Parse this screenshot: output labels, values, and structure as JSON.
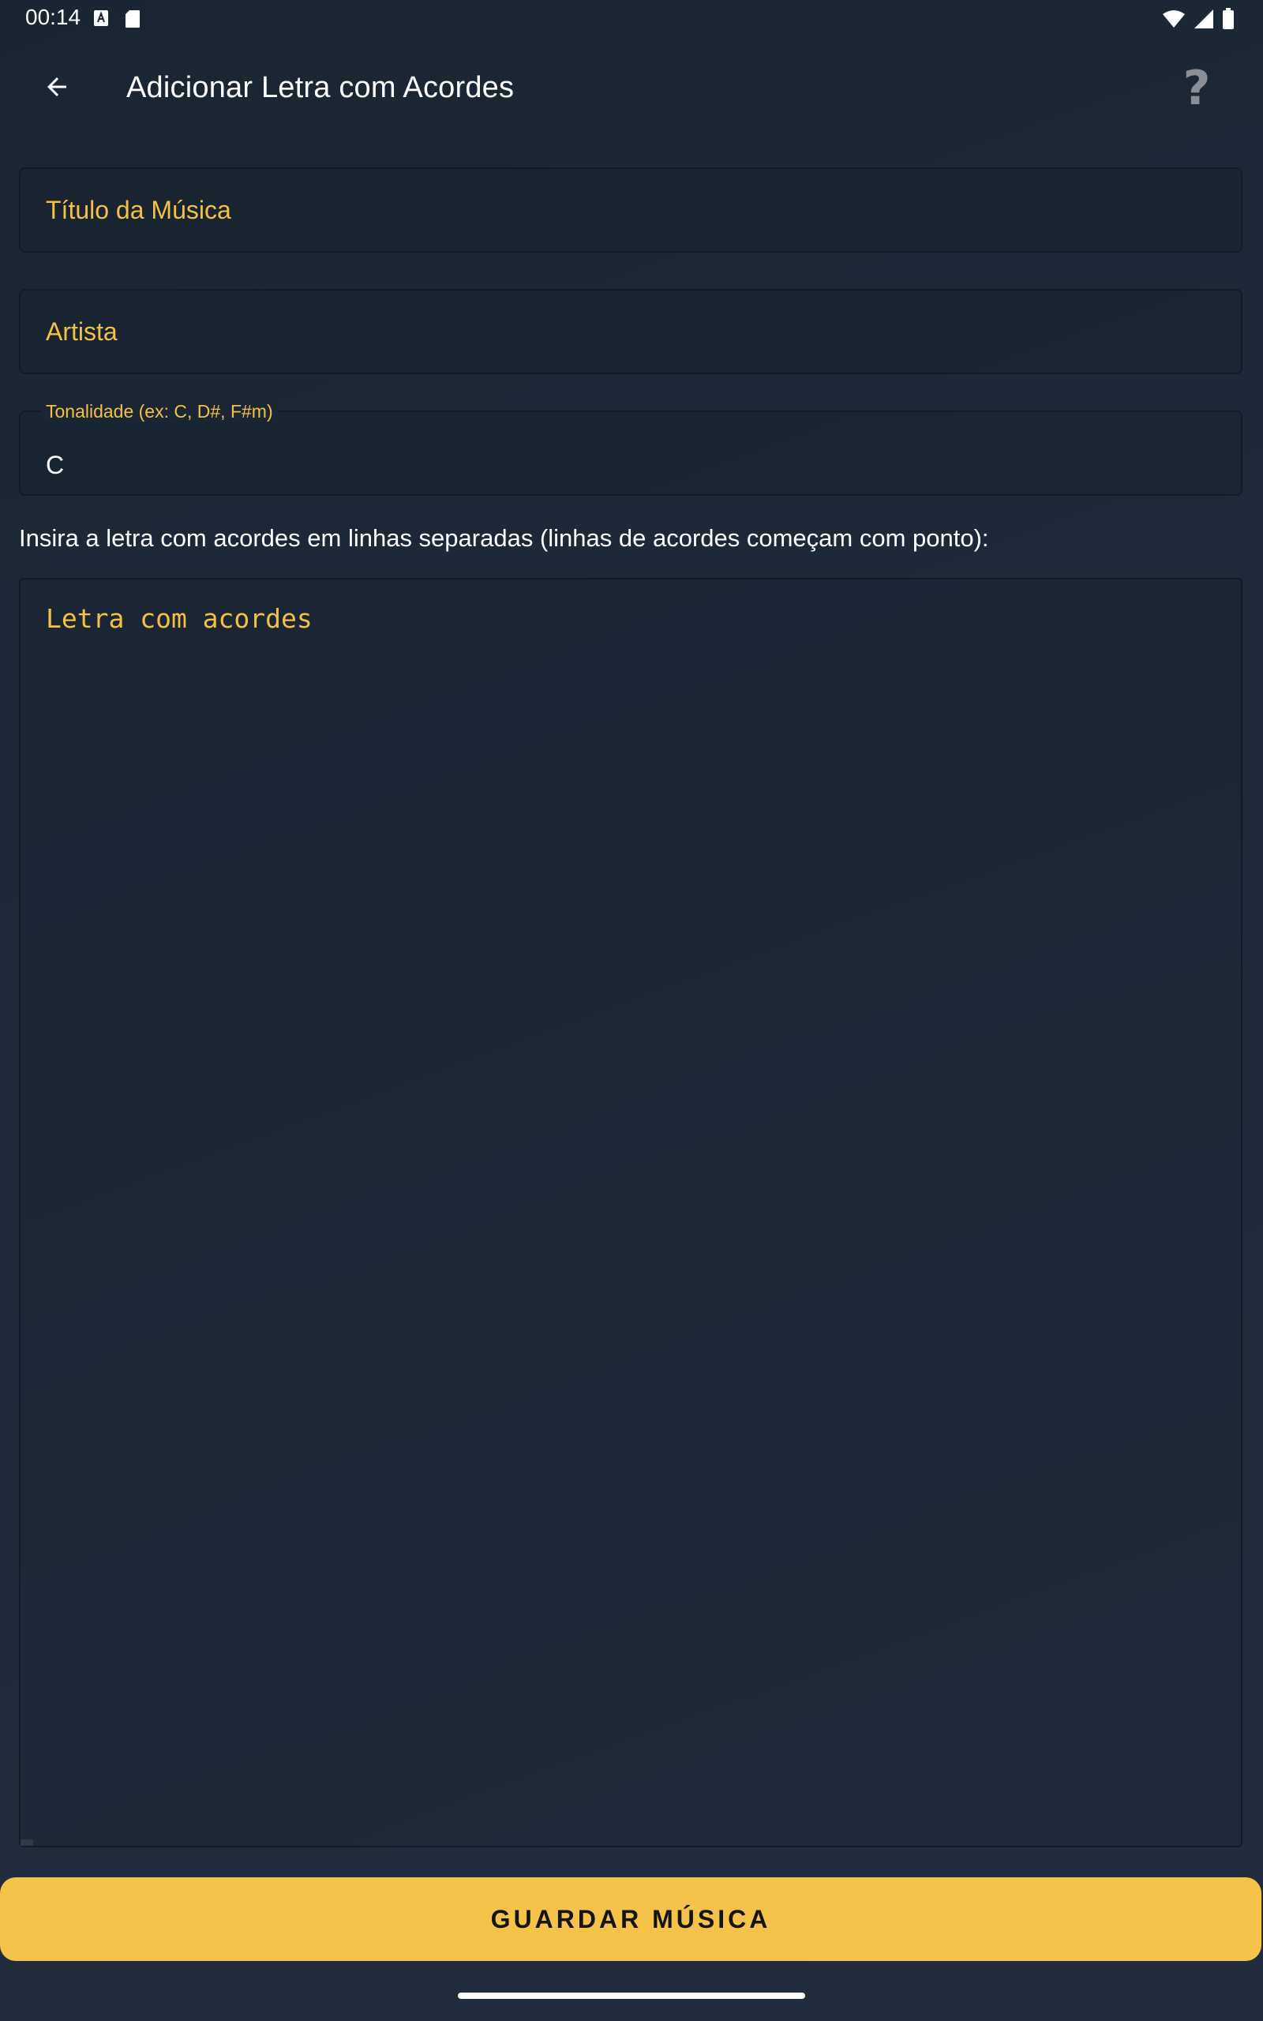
{
  "status_bar": {
    "time": "00:14",
    "left_icons": [
      "a-notification-icon",
      "sd-card-icon"
    ],
    "right_icons": [
      "wifi-icon",
      "signal-icon",
      "battery-icon"
    ]
  },
  "app_bar": {
    "title": "Adicionar Letra com Acordes",
    "back_icon": "arrow-left-icon",
    "help_label": "?"
  },
  "form": {
    "title_field": {
      "placeholder": "Título da Música",
      "value": ""
    },
    "artist_field": {
      "placeholder": "Artista",
      "value": ""
    },
    "key_field": {
      "label": "Tonalidade (ex: C, D#, F#m)",
      "value": "C"
    },
    "instructions": "Insira a letra com acordes em linhas separadas (linhas de acordes começam com ponto):",
    "lyrics_field": {
      "placeholder": "Letra com acordes",
      "value": ""
    }
  },
  "save_button": {
    "label": "GUARDAR MÚSICA"
  },
  "colors": {
    "accent": "#f5c24a",
    "background": "#1e2a3a",
    "placeholder": "#f5c043"
  }
}
